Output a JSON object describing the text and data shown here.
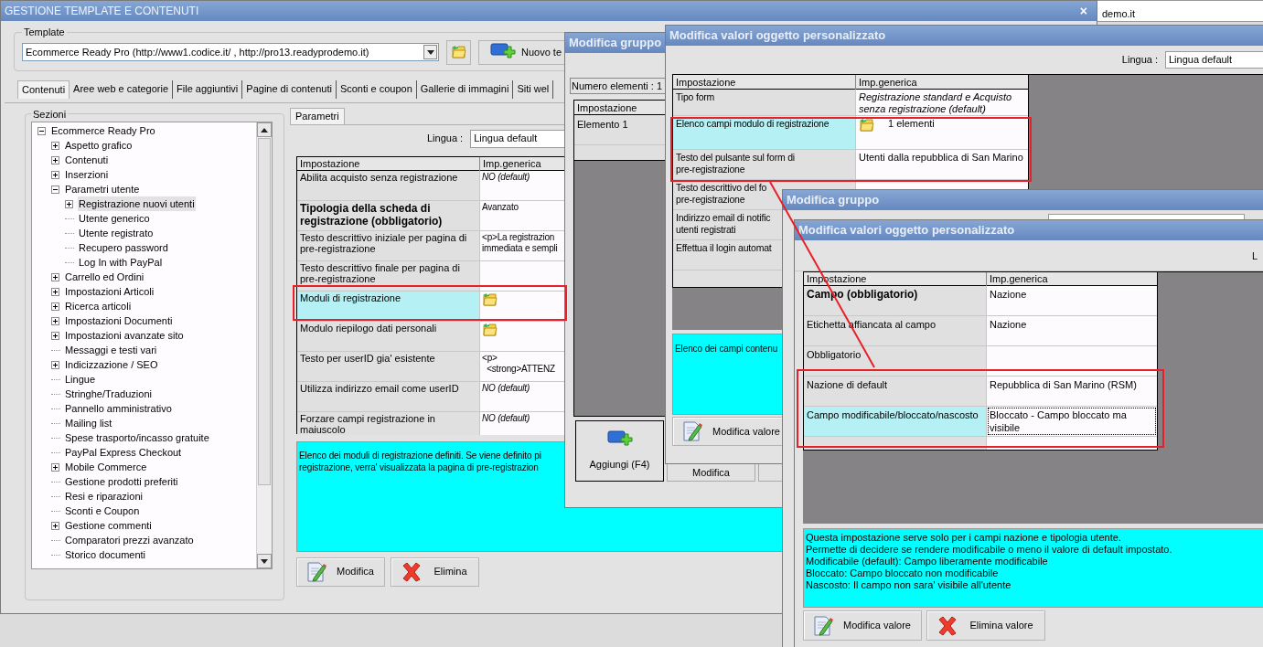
{
  "background_window": {
    "title_fragment": "demo.it"
  },
  "window": {
    "title": "GESTIONE TEMPLATE E CONTENUTI",
    "close": "×"
  },
  "template": {
    "label": "Template",
    "value": "Ecommerce Ready Pro (http://www1.codice.it/ , http://pro13.readyprodemo.it)",
    "new_button": "Nuovo te"
  },
  "tabs": [
    {
      "label": "Contenuti",
      "selected": true
    },
    {
      "label": "Aree web e categorie",
      "selected": false
    },
    {
      "label": "File aggiuntivi",
      "selected": false
    },
    {
      "label": "Pagine di contenuti",
      "selected": false
    },
    {
      "label": "Sconti e coupon",
      "selected": false
    },
    {
      "label": "Gallerie di immagini",
      "selected": false
    },
    {
      "label": "Siti wel",
      "selected": false
    }
  ],
  "sections": {
    "label": "Sezioni",
    "tree": [
      {
        "label": "Ecommerce Ready Pro",
        "expanded": true,
        "selected": false,
        "children": [
          {
            "label": "Aspetto grafico",
            "expanded": false,
            "selected": false
          },
          {
            "label": "Contenuti",
            "expanded": false,
            "selected": false
          },
          {
            "label": "Inserzioni",
            "expanded": false,
            "selected": false
          },
          {
            "label": "Parametri utente",
            "expanded": true,
            "selected": false,
            "children": [
              {
                "label": "Registrazione nuovi utenti",
                "expanded": false,
                "selected": true
              },
              {
                "label": "Utente generico",
                "selected": false
              },
              {
                "label": "Utente registrato",
                "selected": false
              },
              {
                "label": "Recupero password",
                "selected": false
              },
              {
                "label": "Log In with PayPal",
                "selected": false
              }
            ]
          },
          {
            "label": "Carrello ed Ordini",
            "expanded": false,
            "selected": false
          },
          {
            "label": "Impostazioni Articoli",
            "expanded": false,
            "selected": false
          },
          {
            "label": "Ricerca articoli",
            "expanded": false,
            "selected": false
          },
          {
            "label": "Impostazioni Documenti",
            "expanded": false,
            "selected": false
          },
          {
            "label": "Impostazioni avanzate sito",
            "expanded": false,
            "selected": false
          },
          {
            "label": "Messaggi e testi vari",
            "selected": false
          },
          {
            "label": "Indicizzazione / SEO",
            "expanded": false,
            "selected": false
          },
          {
            "label": "Lingue",
            "selected": false
          },
          {
            "label": "Stringhe/Traduzioni",
            "selected": false
          },
          {
            "label": "Pannello amministrativo",
            "selected": false
          },
          {
            "label": "Mailing list",
            "selected": false
          },
          {
            "label": "Spese trasporto/incasso gratuite",
            "selected": false
          },
          {
            "label": "PayPal Express Checkout",
            "selected": false
          },
          {
            "label": "Mobile Commerce",
            "expanded": false,
            "selected": false
          },
          {
            "label": "Gestione prodotti preferiti",
            "selected": false
          },
          {
            "label": "Resi e riparazioni",
            "selected": false
          },
          {
            "label": "Sconti e Coupon",
            "selected": false
          },
          {
            "label": "Gestione commenti",
            "expanded": false,
            "selected": false
          },
          {
            "label": "Comparatori prezzi avanzato",
            "selected": false
          },
          {
            "label": "Storico documenti",
            "selected": false
          }
        ]
      }
    ]
  },
  "params": {
    "tab": {
      "label": "Parametri",
      "selected": true
    },
    "language_label": "Lingua :",
    "language": "Lingua default",
    "columns": [
      "Impostazione",
      "Imp.generica"
    ],
    "rows": [
      {
        "setting": "Abilita acquisto senza registrazione",
        "bold": false,
        "selected": false,
        "value": {
          "kind": "default",
          "lines": [
            "NO (default)"
          ]
        }
      },
      {
        "setting": "Tipologia della scheda di registrazione (obbligatorio)",
        "bold": true,
        "selected": false,
        "value": {
          "kind": "text",
          "lines": [
            "Avanzato"
          ]
        }
      },
      {
        "setting": "Testo descrittivo iniziale per pagina di pre-registrazione",
        "bold": false,
        "selected": false,
        "value": {
          "kind": "text",
          "lines": [
            "<p>La registrazion",
            "immediata e sempli"
          ]
        }
      },
      {
        "setting": "Testo descrittivo finale per pagina di pre-registrazione",
        "bold": false,
        "selected": false
      },
      {
        "setting": "Moduli di registrazione",
        "bold": false,
        "selected": true,
        "value": {
          "kind": "folder"
        }
      },
      {
        "setting": "Modulo riepilogo dati personali",
        "bold": false,
        "selected": false,
        "value": {
          "kind": "folder"
        }
      },
      {
        "setting": "Testo per userID gia' esistente",
        "bold": false,
        "selected": false,
        "value": {
          "kind": "text",
          "lines": [
            "<p>",
            "  <strong>ATTENZ"
          ]
        }
      },
      {
        "setting": "Utilizza indirizzo email come userID",
        "bold": false,
        "selected": false,
        "value": {
          "kind": "default",
          "lines": [
            "NO (default)"
          ]
        }
      },
      {
        "setting": "Forzare campi registrazione in maiuscolo",
        "bold": false,
        "selected": false,
        "value": {
          "kind": "default",
          "lines": [
            "NO (default)"
          ]
        }
      }
    ],
    "description": [
      "Elenco dei moduli di registrazione definiti. Se viene definito pi",
      "registrazione, verra' visualizzata la pagina di pre-registrazion"
    ],
    "buttons": [
      {
        "kind": "edit",
        "label": "Modifica"
      },
      {
        "kind": "delete",
        "label": "Elimina"
      }
    ]
  },
  "group_dialog": {
    "title": "Modifica gruppo",
    "count": "Numero elementi : 1",
    "column": "Impostazione",
    "rows": [
      "Elemento 1"
    ],
    "buttons": [
      {
        "kind": "add",
        "label": "Aggiungi (F4)"
      },
      {
        "kind": "plain",
        "label": "Modifica"
      }
    ]
  },
  "values_dialog": {
    "title": "Modifica valori oggetto personalizzato",
    "language_label": "Lingua :",
    "language": "Lingua default",
    "columns": [
      "Impostazione",
      "Imp.generica"
    ],
    "rows": [
      {
        "setting": [
          "Tipo form"
        ],
        "selected": false,
        "value": {
          "kind": "default",
          "lines": [
            "Registrazione standard e Acquisto",
            "senza registrazione (default)"
          ]
        }
      },
      {
        "setting": [
          "Elenco campi modulo di registrazione"
        ],
        "selected": true,
        "value": {
          "kind": "folder",
          "lines": [
            "1 elementi"
          ]
        }
      },
      {
        "setting": [
          "Testo del pulsante sul form di",
          "pre-registrazione"
        ],
        "selected": false,
        "value": {
          "kind": "text",
          "lines": [
            "Utenti dalla repubblica di San Marino"
          ]
        }
      },
      {
        "setting": [
          "Testo descrittivo del fo",
          "pre-registrazione"
        ],
        "selected": false
      },
      {
        "setting": [
          "Indirizzo email di notific",
          "utenti registrati"
        ],
        "selected": false
      },
      {
        "setting": [
          "Effettua il login automat"
        ],
        "selected": false
      }
    ],
    "description": "Elenco dei campi contenu",
    "buttons": [
      {
        "kind": "edit",
        "label": "Modifica valore"
      }
    ]
  },
  "group_dialog_2": {
    "title": "Modifica gruppo"
  },
  "values_dialog_2": {
    "title": "Modifica valori oggetto personalizzato",
    "language_label": "L",
    "columns": [
      "Impostazione",
      "Imp.generica"
    ],
    "rows": [
      {
        "setting": "Campo (obbligatorio)",
        "bold": true,
        "selected": false,
        "focused": false,
        "value": "Nazione"
      },
      {
        "setting": "Etichetta affiancata al campo",
        "bold": false,
        "selected": false,
        "focused": false,
        "value": "Nazione"
      },
      {
        "setting": "Obbligatorio",
        "bold": false,
        "selected": false,
        "focused": false
      },
      {
        "setting": "Nazione di default",
        "bold": false,
        "selected": false,
        "focused": false,
        "value": "Repubblica di San Marino (RSM)"
      },
      {
        "setting": "Campo modificabile/bloccato/nascosto",
        "bold": false,
        "selected": true,
        "focused": true,
        "value": "Bloccato - Campo bloccato ma visibile"
      }
    ],
    "description": [
      "Questa impostazione serve solo per i campi nazione e tipologia utente.",
      "Permette di decidere se rendere modificabile o meno il valore di default impostato.",
      "Modificabile (default): Campo liberamente modificabile",
      "Bloccato: Campo bloccato non modificabile",
      "Nascosto: Il campo non sara' visibile all'utente"
    ],
    "buttons": [
      {
        "kind": "edit",
        "label": "Modifica valore"
      },
      {
        "kind": "delete",
        "label": "Elimina valore"
      }
    ]
  }
}
